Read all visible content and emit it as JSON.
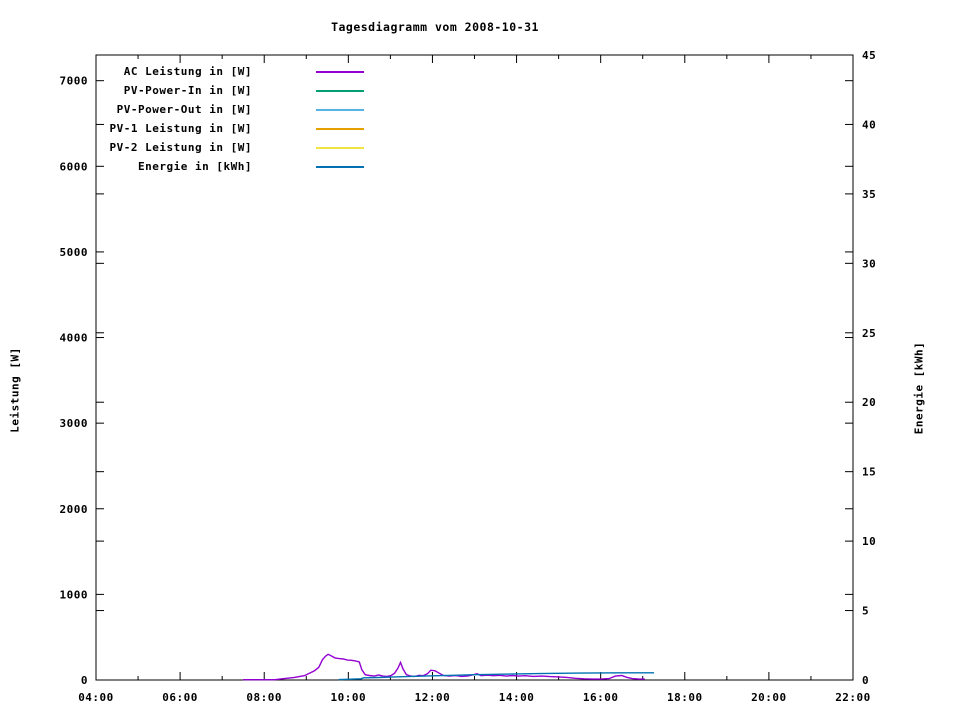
{
  "chart_data": {
    "type": "line",
    "title": "Tagesdiagramm vom 2008-10-31",
    "ylabel_left": "Leistung [W]",
    "ylabel_right": "Energie [kWh]",
    "colors": {
      "background": "#ffffff",
      "axis": "#000000"
    },
    "legend_position": "top-left-inside",
    "grid": false,
    "x_axis": {
      "unit": "time",
      "min_hour": 4,
      "max_hour": 22,
      "major_tick_hours": [
        4,
        6,
        8,
        10,
        12,
        14,
        16,
        18,
        20,
        22
      ],
      "major_tick_labels": [
        "04:00",
        "06:00",
        "08:00",
        "10:00",
        "12:00",
        "14:00",
        "16:00",
        "18:00",
        "20:00",
        "22:00"
      ],
      "minor_tick_hours": [
        5,
        7,
        9,
        11,
        13,
        15,
        17,
        19,
        21
      ]
    },
    "y_left_axis": {
      "min": 0,
      "max": 7300,
      "tick_values": [
        0,
        1000,
        2000,
        3000,
        4000,
        5000,
        6000,
        7000
      ],
      "tick_labels": [
        "0",
        "1000",
        "2000",
        "3000",
        "4000",
        "5000",
        "6000",
        "7000"
      ]
    },
    "y_right_axis": {
      "min": 0,
      "max": 45,
      "tick_values": [
        0,
        5,
        10,
        15,
        20,
        25,
        30,
        35,
        40,
        45
      ],
      "tick_labels": [
        "0",
        "5",
        "10",
        "15",
        "20",
        "25",
        "30",
        "35",
        "40",
        "45"
      ]
    },
    "series": [
      {
        "name": "AC Leistung in [W]",
        "color": "#9400d3",
        "axis": "left",
        "points": [
          [
            7.5,
            4
          ],
          [
            8.25,
            4
          ],
          [
            8.45,
            15
          ],
          [
            8.7,
            28
          ],
          [
            8.95,
            50
          ],
          [
            9.1,
            85
          ],
          [
            9.2,
            110
          ],
          [
            9.3,
            150
          ],
          [
            9.38,
            235
          ],
          [
            9.45,
            275
          ],
          [
            9.52,
            300
          ],
          [
            9.6,
            280
          ],
          [
            9.68,
            258
          ],
          [
            9.78,
            250
          ],
          [
            9.88,
            245
          ],
          [
            9.98,
            232
          ],
          [
            10.08,
            230
          ],
          [
            10.18,
            222
          ],
          [
            10.26,
            210
          ],
          [
            10.32,
            120
          ],
          [
            10.4,
            62
          ],
          [
            10.5,
            52
          ],
          [
            10.62,
            46
          ],
          [
            10.72,
            58
          ],
          [
            10.82,
            46
          ],
          [
            10.92,
            42
          ],
          [
            11.02,
            52
          ],
          [
            11.1,
            80
          ],
          [
            11.18,
            140
          ],
          [
            11.24,
            205
          ],
          [
            11.3,
            130
          ],
          [
            11.38,
            62
          ],
          [
            11.48,
            46
          ],
          [
            11.58,
            42
          ],
          [
            11.68,
            55
          ],
          [
            11.78,
            50
          ],
          [
            11.88,
            72
          ],
          [
            11.96,
            115
          ],
          [
            12.06,
            108
          ],
          [
            12.16,
            80
          ],
          [
            12.26,
            52
          ],
          [
            12.4,
            46
          ],
          [
            12.55,
            52
          ],
          [
            12.7,
            42
          ],
          [
            12.85,
            48
          ],
          [
            12.98,
            62
          ],
          [
            13.06,
            72
          ],
          [
            13.16,
            50
          ],
          [
            13.3,
            56
          ],
          [
            13.45,
            50
          ],
          [
            13.6,
            55
          ],
          [
            13.75,
            46
          ],
          [
            13.9,
            52
          ],
          [
            14.05,
            46
          ],
          [
            14.2,
            50
          ],
          [
            14.4,
            42
          ],
          [
            14.6,
            46
          ],
          [
            14.8,
            40
          ],
          [
            15.0,
            36
          ],
          [
            15.2,
            30
          ],
          [
            15.4,
            20
          ],
          [
            15.6,
            14
          ],
          [
            15.8,
            11
          ],
          [
            16.0,
            10
          ],
          [
            16.2,
            16
          ],
          [
            16.35,
            46
          ],
          [
            16.5,
            52
          ],
          [
            16.62,
            32
          ],
          [
            16.75,
            16
          ],
          [
            16.9,
            12
          ],
          [
            17.05,
            10
          ]
        ]
      },
      {
        "name": "PV-Power-In in [W]",
        "color": "#009e73",
        "axis": "left",
        "points": []
      },
      {
        "name": "PV-Power-Out in [W]",
        "color": "#56b4e9",
        "axis": "left",
        "points": []
      },
      {
        "name": "PV-1 Leistung in [W]",
        "color": "#e69f00",
        "axis": "left",
        "points": []
      },
      {
        "name": "PV-2 Leistung in [W]",
        "color": "#f0e442",
        "axis": "left",
        "points": []
      },
      {
        "name": "Energie in [kWh]",
        "color": "#0072b2",
        "axis": "right",
        "points": [
          [
            9.77,
            0.03
          ],
          [
            10.05,
            0.06
          ],
          [
            10.3,
            0.09
          ],
          [
            10.36,
            0.16
          ],
          [
            10.7,
            0.18
          ],
          [
            11.0,
            0.21
          ],
          [
            11.5,
            0.26
          ],
          [
            12.0,
            0.3
          ],
          [
            12.5,
            0.34
          ],
          [
            13.0,
            0.38
          ],
          [
            13.5,
            0.41
          ],
          [
            14.0,
            0.44
          ],
          [
            14.5,
            0.46
          ],
          [
            15.0,
            0.48
          ],
          [
            15.5,
            0.5
          ],
          [
            16.0,
            0.51
          ],
          [
            16.5,
            0.52
          ],
          [
            17.0,
            0.52
          ],
          [
            17.27,
            0.52
          ]
        ]
      }
    ]
  }
}
